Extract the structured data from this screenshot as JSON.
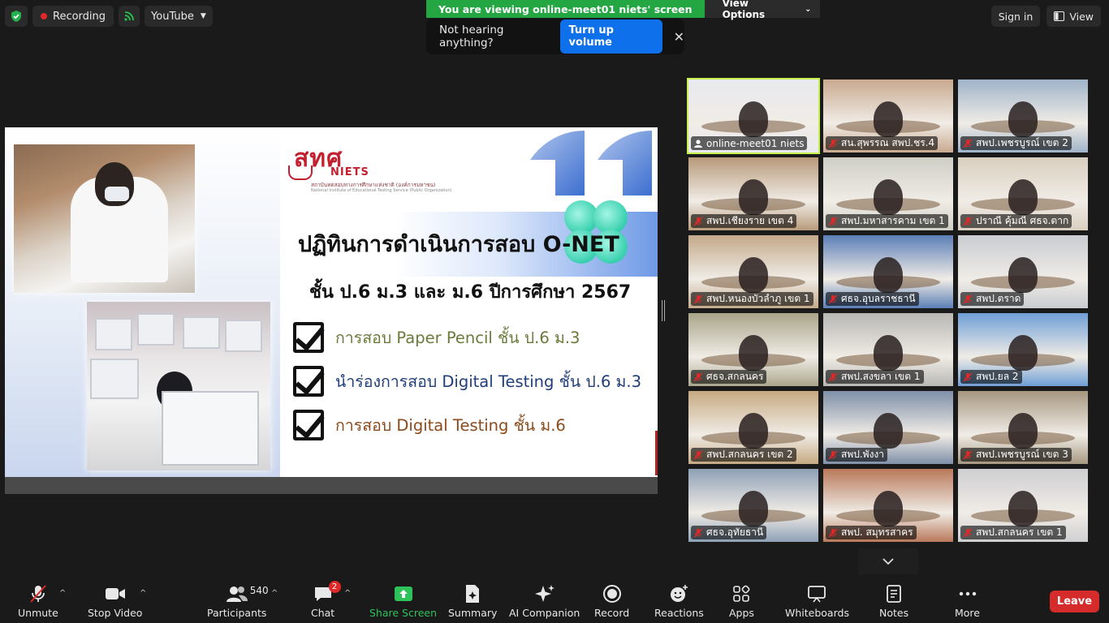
{
  "top_bar": {
    "recording_label": "Recording",
    "stream_label": "YouTube",
    "banner_text": "You are viewing online-meet01 niets' screen",
    "view_options_label": "View Options",
    "sign_in_label": "Sign in",
    "view_label": "View"
  },
  "toast": {
    "message": "Not hearing anything?",
    "button_label": "Turn up volume",
    "close_glyph": "✕"
  },
  "slide": {
    "logo_mark": "สทศ",
    "logo_sub": "NIETS",
    "logo_line1": "สถาบันทดสอบทางการศึกษาแห่งชาติ (องค์การมหาชน)",
    "logo_line2": "National Institute of Educational Testing Service (Public Organization)",
    "title": "ปฏิทินการดำเนินการสอบ O-NET",
    "subtitle": "ชั้น ป.6 ม.3 และ ม.6 ปีการศึกษา 2567",
    "items": [
      {
        "text": "การสอบ Paper Pencil ชั้น ป.6 ม.3",
        "color": "#6a7a3a"
      },
      {
        "text": "นำร่องการสอบ Digital Testing ชั้น ป.6 ม.3",
        "color": "#1f3d7a"
      },
      {
        "text": "การสอบ Digital Testing ชั้น ม.6",
        "color": "#8a4a1a"
      }
    ]
  },
  "gallery": {
    "tiles": [
      {
        "label": "online-meet01 niets",
        "active": true,
        "host": true,
        "bg": "#e9e9ef"
      },
      {
        "label": "สน.สุพรรณ  สพป.ชร.4",
        "bg": "#c9a98f"
      },
      {
        "label": "สพป.เพชรบูรณ์ เขต 2",
        "bg": "#9fb3c9"
      },
      {
        "label": "สพป.เชียงราย เขต 4",
        "bg": "#b89a7a"
      },
      {
        "label": "สพป.มหาสารคาม เขต 1",
        "bg": "#cfcfc6"
      },
      {
        "label": "ปราณี คุ้มณี ศธจ.ตาก",
        "bg": "#d9cfbf"
      },
      {
        "label": "สพป.หนองบัวลำภู เขต 1",
        "bg": "#c4a98a"
      },
      {
        "label": "ศธจ.อุบลราชธานี",
        "bg": "#5b7fb6"
      },
      {
        "label": "สพป.ตราด",
        "bg": "#c9ccd1"
      },
      {
        "label": "ศธจ.สกลนคร",
        "bg": "#a9a58a"
      },
      {
        "label": "สพป.สงขลา เขต 1",
        "bg": "#b8b7b3"
      },
      {
        "label": "สพป.ยล 2",
        "bg": "#6f9fd6"
      },
      {
        "label": "สพป.สกลนคร เขต 2",
        "bg": "#c7aa82"
      },
      {
        "label": "สพป.พังงา",
        "bg": "#7e8fa8"
      },
      {
        "label": "สพป.เพชรบูรณ์ เขต 3",
        "bg": "#a69780"
      },
      {
        "label": "ศธจ.อุทัยธานี",
        "bg": "#8fa1b6"
      },
      {
        "label": "สพป. สมุทรสาคร",
        "bg": "#b9785a"
      },
      {
        "label": "สพป.สกลนคร เขต 1",
        "bg": "#cfcfd2"
      }
    ]
  },
  "toolbar": {
    "unmute": "Unmute",
    "stop_video": "Stop Video",
    "participants": "Participants",
    "participants_count": "540",
    "chat": "Chat",
    "chat_badge": "2",
    "share_screen": "Share Screen",
    "summary": "Summary",
    "ai_companion": "AI Companion",
    "record": "Record",
    "reactions": "Reactions",
    "apps": "Apps",
    "whiteboards": "Whiteboards",
    "notes": "Notes",
    "more": "More",
    "leave": "Leave"
  },
  "colors": {
    "accent_green": "#24a743",
    "blue_button": "#0e71eb",
    "leave_red": "#d52b2b",
    "active_tile_border": "#c8f04a"
  }
}
